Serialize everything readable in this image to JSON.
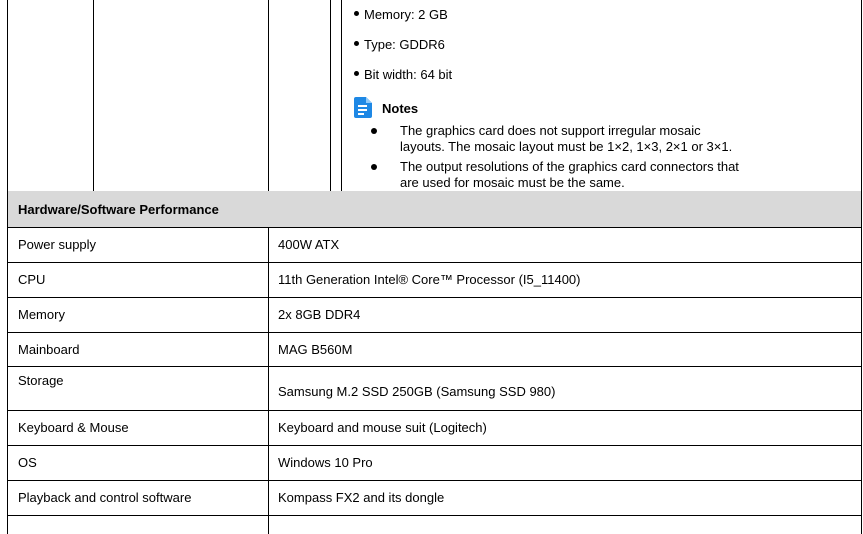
{
  "gpu_specs": {
    "bullets": [
      "Memory: 2 GB",
      "Type: GDDR6",
      "Bit width: 64 bit"
    ],
    "notes_title": "Notes",
    "notes": [
      [
        "The graphics card does not support irregular mosaic",
        "layouts. The mosaic layout must be 1×2, 1×3, 2×1 or 3×1."
      ],
      [
        "The output resolutions of the graphics card connectors that",
        "are used for mosaic must be the same."
      ]
    ]
  },
  "section_title": "Hardware/Software Performance",
  "rows": [
    {
      "label": "Power supply",
      "value": "400W ATX"
    },
    {
      "label": "CPU",
      "value": "11th Generation Intel® Core™ Processor (I5_11400)"
    },
    {
      "label": "Memory",
      "value": "2x 8GB DDR4"
    },
    {
      "label": "Mainboard",
      "value": "MAG B560M"
    },
    {
      "label": "Storage",
      "value": "Samsung M.2 SSD 250GB (Samsung SSD 980)"
    },
    {
      "label": "Keyboard & Mouse",
      "value": "Keyboard and mouse suit (Logitech)"
    },
    {
      "label": "OS",
      "value": "Windows 10 Pro"
    },
    {
      "label": "Playback and control software",
      "value": "Kompass FX2 and its dongle"
    }
  ],
  "colors": {
    "notes_icon": "#1e88e5",
    "section_bg": "#d9d9d9"
  }
}
